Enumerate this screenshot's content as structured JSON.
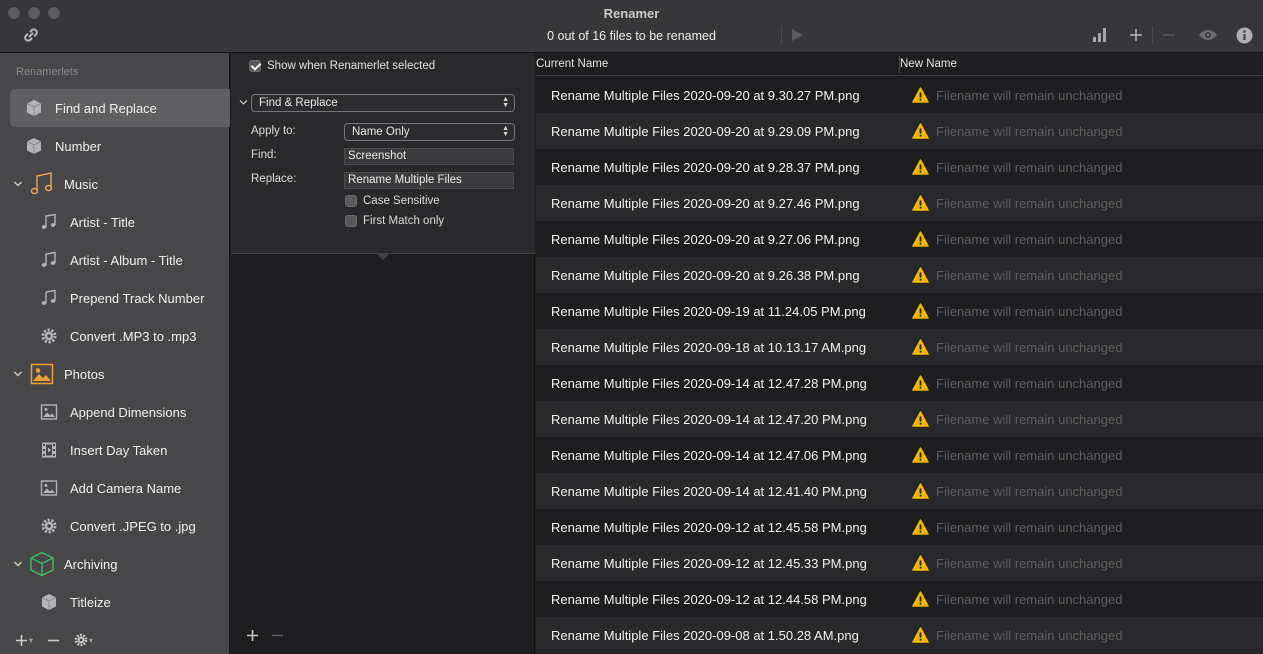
{
  "window": {
    "title": "Renamer",
    "status": "0 out of 16 files to be renamed"
  },
  "sidebar": {
    "header": "Renamerlets",
    "items": [
      {
        "label": "Find and Replace",
        "icon": "box-icon",
        "level": 0,
        "selected": true
      },
      {
        "label": "Number",
        "icon": "box-icon",
        "level": 0
      },
      {
        "label": "Music",
        "icon": "music-group-icon",
        "level": "group"
      },
      {
        "label": "Artist - Title",
        "icon": "music-note-icon",
        "level": 1
      },
      {
        "label": "Artist - Album - Title",
        "icon": "music-note-icon",
        "level": 1
      },
      {
        "label": "Prepend Track Number",
        "icon": "music-note-icon",
        "level": 1
      },
      {
        "label": "Convert .MP3 to .mp3",
        "icon": "gear-icon",
        "level": 1
      },
      {
        "label": "Photos",
        "icon": "photos-group-icon",
        "level": "group"
      },
      {
        "label": "Append Dimensions",
        "icon": "image-icon",
        "level": 1
      },
      {
        "label": "Insert Day Taken",
        "icon": "film-icon",
        "level": 1
      },
      {
        "label": "Add Camera Name",
        "icon": "image-icon",
        "level": 1
      },
      {
        "label": "Convert .JPEG to .jpg",
        "icon": "gear-icon",
        "level": 1
      },
      {
        "label": "Archiving",
        "icon": "archive-cube-icon",
        "level": "group"
      },
      {
        "label": "Titleize",
        "icon": "box-icon",
        "level": 1
      }
    ]
  },
  "editor": {
    "show_when_label": "Show when Renamerlet selected",
    "type_select": "Find & Replace",
    "apply_to_label": "Apply to:",
    "apply_to_value": "Name Only",
    "find_label": "Find:",
    "find_value": "Screenshot",
    "replace_label": "Replace:",
    "replace_value": "Rename Multiple Files",
    "case_sensitive_label": "Case Sensitive",
    "first_match_label": "First Match only"
  },
  "table": {
    "col_current": "Current Name",
    "col_new": "New Name",
    "unchanged_text": "Filename will remain unchanged",
    "files": [
      "Rename Multiple Files 2020-09-20 at 9.30.27 PM.png",
      "Rename Multiple Files 2020-09-20 at 9.29.09 PM.png",
      "Rename Multiple Files 2020-09-20 at 9.28.37 PM.png",
      "Rename Multiple Files 2020-09-20 at 9.27.46 PM.png",
      "Rename Multiple Files 2020-09-20 at 9.27.06 PM.png",
      "Rename Multiple Files 2020-09-20 at 9.26.38 PM.png",
      "Rename Multiple Files 2020-09-19 at 11.24.05 PM.png",
      "Rename Multiple Files 2020-09-18 at 10.13.17 AM.png",
      "Rename Multiple Files 2020-09-14 at 12.47.28 PM.png",
      "Rename Multiple Files 2020-09-14 at 12.47.20 PM.png",
      "Rename Multiple Files 2020-09-14 at 12.47.06 PM.png",
      "Rename Multiple Files 2020-09-14 at 12.41.40 PM.png",
      "Rename Multiple Files 2020-09-12 at 12.45.58 PM.png",
      "Rename Multiple Files 2020-09-12 at 12.45.33 PM.png",
      "Rename Multiple Files 2020-09-12 at 12.44.58 PM.png",
      "Rename Multiple Files 2020-09-08 at 1.50.28 AM.png"
    ]
  },
  "colors": {
    "warning": "#f5b700",
    "music_accent": "#e8a24a",
    "photos_accent": "#f0a030",
    "archive_accent": "#3fbf5f"
  }
}
